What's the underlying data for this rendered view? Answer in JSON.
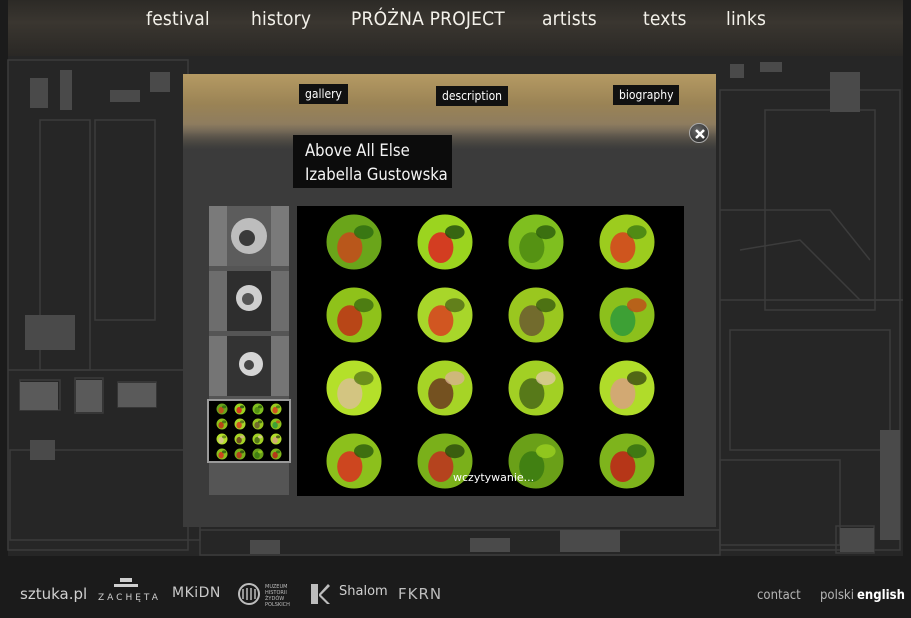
{
  "nav": {
    "items": [
      "festival",
      "history",
      "PRÓŻNA PROJECT",
      "artists",
      "texts",
      "links"
    ]
  },
  "modal": {
    "tabs": [
      "gallery",
      "description",
      "biography"
    ],
    "title_line1": "Above All Else",
    "title_line2": "Izabella Gustowska",
    "loading_text": "wczytywanie..."
  },
  "footer": {
    "logos": [
      "sztuka.pl",
      "ZACHĘTA",
      "MKiDN",
      "MUZEUM HISTORII ŻYDÓW POLSKICH",
      "Shalom",
      "FKRN"
    ],
    "contact": "contact",
    "lang_polish": "polski",
    "lang_english": "english"
  },
  "colors": {
    "background": "#1a1a1a",
    "modal": "#3b3b3b",
    "viewer_green": "#8fc21a"
  }
}
